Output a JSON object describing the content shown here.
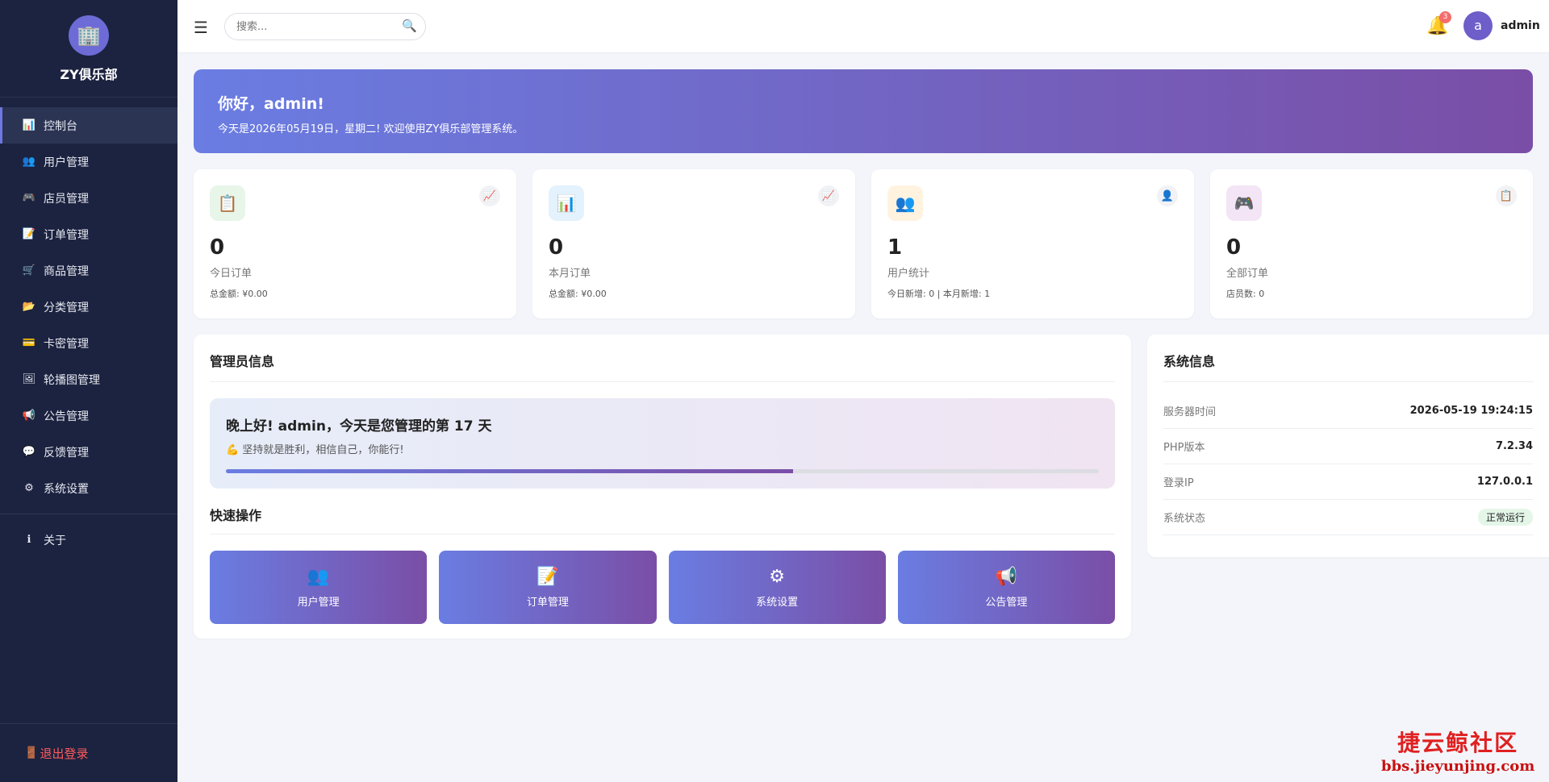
{
  "brand": {
    "logo_icon": "🏢",
    "name": "ZY俱乐部"
  },
  "nav": {
    "items": [
      {
        "icon": "📊",
        "label": "控制台",
        "active": true
      },
      {
        "icon": "👥",
        "label": "用户管理"
      },
      {
        "icon": "🎮",
        "label": "店员管理"
      },
      {
        "icon": "📝",
        "label": "订单管理"
      },
      {
        "icon": "🛒",
        "label": "商品管理"
      },
      {
        "icon": "📂",
        "label": "分类管理"
      },
      {
        "icon": "💳",
        "label": "卡密管理"
      },
      {
        "icon": "🖼",
        "label": "轮播图管理"
      },
      {
        "icon": "📢",
        "label": "公告管理"
      },
      {
        "icon": "💬",
        "label": "反馈管理"
      },
      {
        "icon": "⚙",
        "label": "系统设置"
      }
    ],
    "about": {
      "icon": "ℹ",
      "label": "关于"
    },
    "logout": {
      "icon": "🚪",
      "label": "退出登录"
    }
  },
  "topbar": {
    "menu_icon": "☰",
    "search_placeholder": "搜索...",
    "search_icon": "🔍",
    "bell_icon": "🔔",
    "notification_count": "3",
    "avatar_letter": "a",
    "username": "admin"
  },
  "welcome": {
    "title": "你好，admin!",
    "subtitle": "今天是2026年05月19日，星期二! 欢迎使用ZY俱乐部管理系统。"
  },
  "stats": [
    {
      "icon": "📋",
      "corner_icon": "📈",
      "value": "0",
      "label": "今日订单",
      "sub": "总金额: ¥0.00",
      "bg": "#e8f5e9"
    },
    {
      "icon": "📊",
      "corner_icon": "📈",
      "value": "0",
      "label": "本月订单",
      "sub": "总金额: ¥0.00",
      "bg": "#e3f2fd"
    },
    {
      "icon": "👥",
      "corner_icon": "👤",
      "value": "1",
      "label": "用户统计",
      "sub": "今日新增: 0 | 本月新增: 1",
      "bg": "#fff3e0"
    },
    {
      "icon": "🎮",
      "corner_icon": "📋",
      "value": "0",
      "label": "全部订单",
      "sub": "店员数: 0",
      "bg": "#f3e5f5"
    }
  ],
  "admin_panel": {
    "title": "管理员信息",
    "greeting": "晚上好! admin，今天是您管理的第 17 天",
    "motto_icon": "💪",
    "motto": "坚持就是胜利，相信自己，你能行!",
    "progress": 0.65,
    "quick_title": "快速操作",
    "quick_actions": [
      {
        "icon": "👥",
        "label": "用户管理"
      },
      {
        "icon": "📝",
        "label": "订单管理"
      },
      {
        "icon": "⚙",
        "label": "系统设置"
      },
      {
        "icon": "📢",
        "label": "公告管理"
      }
    ]
  },
  "system_panel": {
    "title": "系统信息",
    "rows": [
      {
        "key": "服务器时间",
        "value": "2026-05-19 19:24:15"
      },
      {
        "key": "PHP版本",
        "value": "7.2.34"
      },
      {
        "key": "登录IP",
        "value": "127.0.0.1"
      },
      {
        "key": "系统状态",
        "value": "正常运行"
      }
    ]
  },
  "watermark": {
    "line1": "捷云鲸社区",
    "line2": "bbs.jieyunjing.com"
  },
  "colors": {
    "sidebar": "#1c2340",
    "accent_start": "#6a7de2",
    "accent_end": "#7a4ea6",
    "logout": "#ff5b5b"
  }
}
